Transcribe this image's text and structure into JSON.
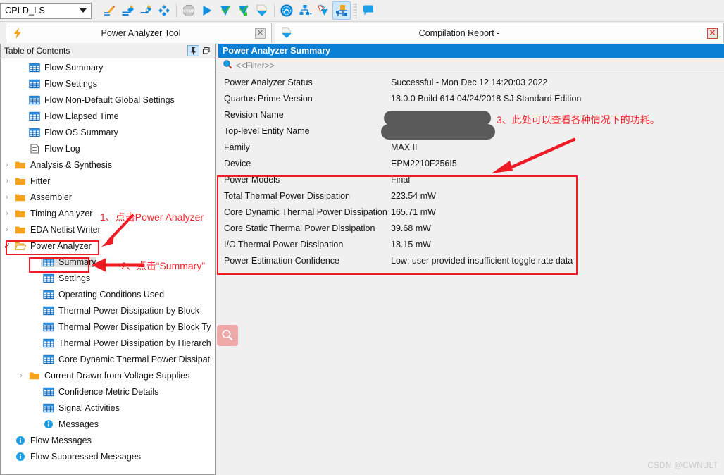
{
  "toolbar": {
    "project_combo": {
      "value": "CPLD_LS",
      "name": "project-revision-combo"
    },
    "buttons": [
      {
        "name": "compile-design-icon",
        "title": "Compile Design"
      },
      {
        "name": "analysis-synthesis-icon",
        "title": "Analysis & Synthesis"
      },
      {
        "name": "fitter-icon",
        "title": "Fitter (Place & Route)"
      },
      {
        "name": "assembler-icon",
        "title": "Assembler"
      },
      {
        "name": "stop-icon",
        "title": "Stop Processing"
      },
      {
        "name": "start-compilation-icon",
        "title": "Start Compilation"
      },
      {
        "name": "check-icon",
        "title": "Start Analysis & Elaboration"
      },
      {
        "name": "check-green-icon",
        "title": "Start Analysis & Synthesis"
      },
      {
        "name": "programmer-icon",
        "title": "Programmer"
      },
      {
        "name": "timing-analyzer-icon",
        "title": "Timing Analyzer"
      },
      {
        "name": "netlist-viewer-icon",
        "title": "Netlist Viewer"
      },
      {
        "name": "signal-tap-icon",
        "title": "Signal Tap"
      },
      {
        "name": "power-analyzer-icon",
        "title": "Power Analyzer Tool"
      },
      {
        "name": "chat-bubble-icon",
        "title": "Messages"
      }
    ]
  },
  "tabs": [
    {
      "name": "tab-power-analyzer-tool",
      "label": "Power Analyzer Tool",
      "icon": "lightning-icon",
      "active": false
    },
    {
      "name": "tab-compilation-report",
      "label": "Compilation Report -",
      "icon": "report-icon",
      "active": true
    }
  ],
  "toc": {
    "header": "Table of Contents",
    "pin_icon": "pin-icon",
    "restore_icon": "restore-window-icon",
    "items": [
      {
        "label": "Flow Summary",
        "icon": "table-icon",
        "indent": 1,
        "expander": ""
      },
      {
        "label": "Flow Settings",
        "icon": "table-icon",
        "indent": 1,
        "expander": ""
      },
      {
        "label": "Flow Non-Default Global Settings",
        "icon": "table-icon",
        "indent": 1,
        "expander": ""
      },
      {
        "label": "Flow Elapsed Time",
        "icon": "table-icon",
        "indent": 1,
        "expander": ""
      },
      {
        "label": "Flow OS Summary",
        "icon": "table-icon",
        "indent": 1,
        "expander": ""
      },
      {
        "label": "Flow Log",
        "icon": "document-icon",
        "indent": 1,
        "expander": ""
      },
      {
        "label": "Analysis & Synthesis",
        "icon": "folder-icon",
        "indent": 0,
        "expander": "collapsed"
      },
      {
        "label": "Fitter",
        "icon": "folder-icon",
        "indent": 0,
        "expander": "collapsed"
      },
      {
        "label": "Assembler",
        "icon": "folder-icon",
        "indent": 0,
        "expander": "collapsed"
      },
      {
        "label": "Timing Analyzer",
        "icon": "folder-icon",
        "indent": 0,
        "expander": "collapsed"
      },
      {
        "label": "EDA Netlist Writer",
        "icon": "folder-icon",
        "indent": 0,
        "expander": "collapsed"
      },
      {
        "label": "Power Analyzer",
        "icon": "folder-open-icon",
        "indent": 0,
        "expander": "expanded"
      },
      {
        "label": "Summary",
        "icon": "table-icon",
        "indent": 2,
        "expander": "",
        "selected": true
      },
      {
        "label": "Settings",
        "icon": "table-icon",
        "indent": 2,
        "expander": ""
      },
      {
        "label": "Operating Conditions Used",
        "icon": "table-icon",
        "indent": 2,
        "expander": ""
      },
      {
        "label": "Thermal Power Dissipation by Block",
        "icon": "table-icon",
        "indent": 2,
        "expander": ""
      },
      {
        "label": "Thermal Power Dissipation by Block Type",
        "icon": "table-icon",
        "indent": 2,
        "expander": ""
      },
      {
        "label": "Thermal Power Dissipation by Hierarchy",
        "icon": "table-icon",
        "indent": 2,
        "expander": ""
      },
      {
        "label": "Core Dynamic Thermal Power Dissipation by",
        "icon": "table-icon",
        "indent": 2,
        "expander": ""
      },
      {
        "label": "Current Drawn from Voltage Supplies",
        "icon": "folder-icon",
        "indent": 1,
        "expander": "collapsed"
      },
      {
        "label": "Confidence Metric Details",
        "icon": "table-icon",
        "indent": 2,
        "expander": ""
      },
      {
        "label": "Signal Activities",
        "icon": "table-icon",
        "indent": 2,
        "expander": ""
      },
      {
        "label": "Messages",
        "icon": "info-icon",
        "indent": 2,
        "expander": ""
      },
      {
        "label": "Flow Messages",
        "icon": "info-icon",
        "indent": 0,
        "expander": ""
      },
      {
        "label": "Flow Suppressed Messages",
        "icon": "info-icon",
        "indent": 0,
        "expander": ""
      }
    ]
  },
  "report": {
    "title": "Power Analyzer Summary",
    "filter_placeholder": "<<Filter>>",
    "filter_icon": "search-icon",
    "rows": [
      {
        "key": "Power Analyzer Status",
        "value": "Successful - Mon Dec 12 14:20:03 2022"
      },
      {
        "key": "Quartus Prime Version",
        "value": "18.0.0 Build 614 04/24/2018 SJ Standard Edition"
      },
      {
        "key": "Revision Name",
        "value": ""
      },
      {
        "key": "Top-level Entity Name",
        "value": ""
      },
      {
        "key": "Family",
        "value": "MAX II"
      },
      {
        "key": "Device",
        "value": "EPM2210F256I5"
      },
      {
        "key": "Power Models",
        "value": "Final"
      },
      {
        "key": "Total Thermal Power Dissipation",
        "value": "223.54 mW"
      },
      {
        "key": "Core Dynamic Thermal Power Dissipation",
        "value": "165.71 mW"
      },
      {
        "key": "Core Static Thermal Power Dissipation",
        "value": "39.68 mW"
      },
      {
        "key": "I/O Thermal Power Dissipation",
        "value": "18.15 mW"
      },
      {
        "key": "Power Estimation Confidence",
        "value": "Low: user provided insufficient toggle rate data"
      }
    ]
  },
  "annotations": [
    {
      "name": "annotation-step-1",
      "text": "1、点击Power Analyzer"
    },
    {
      "name": "annotation-step-2",
      "text": "2、点击“Summary”"
    },
    {
      "name": "annotation-step-3",
      "text": "3、此处可以查看各种情况下的功耗。"
    }
  ],
  "magnifier_button": {
    "name": "zoom-tool-button",
    "icon": "magnifier-icon"
  },
  "watermark": "CSDN @CWNULT",
  "colors": {
    "accent_blue": "#0a7fd4",
    "annotation_red": "#f5222d",
    "box_red": "#ee1b24",
    "folder_orange": "#f5a21e",
    "panel_bg": "#f0f0f0",
    "redaction_gray": "#5a5a5a"
  }
}
